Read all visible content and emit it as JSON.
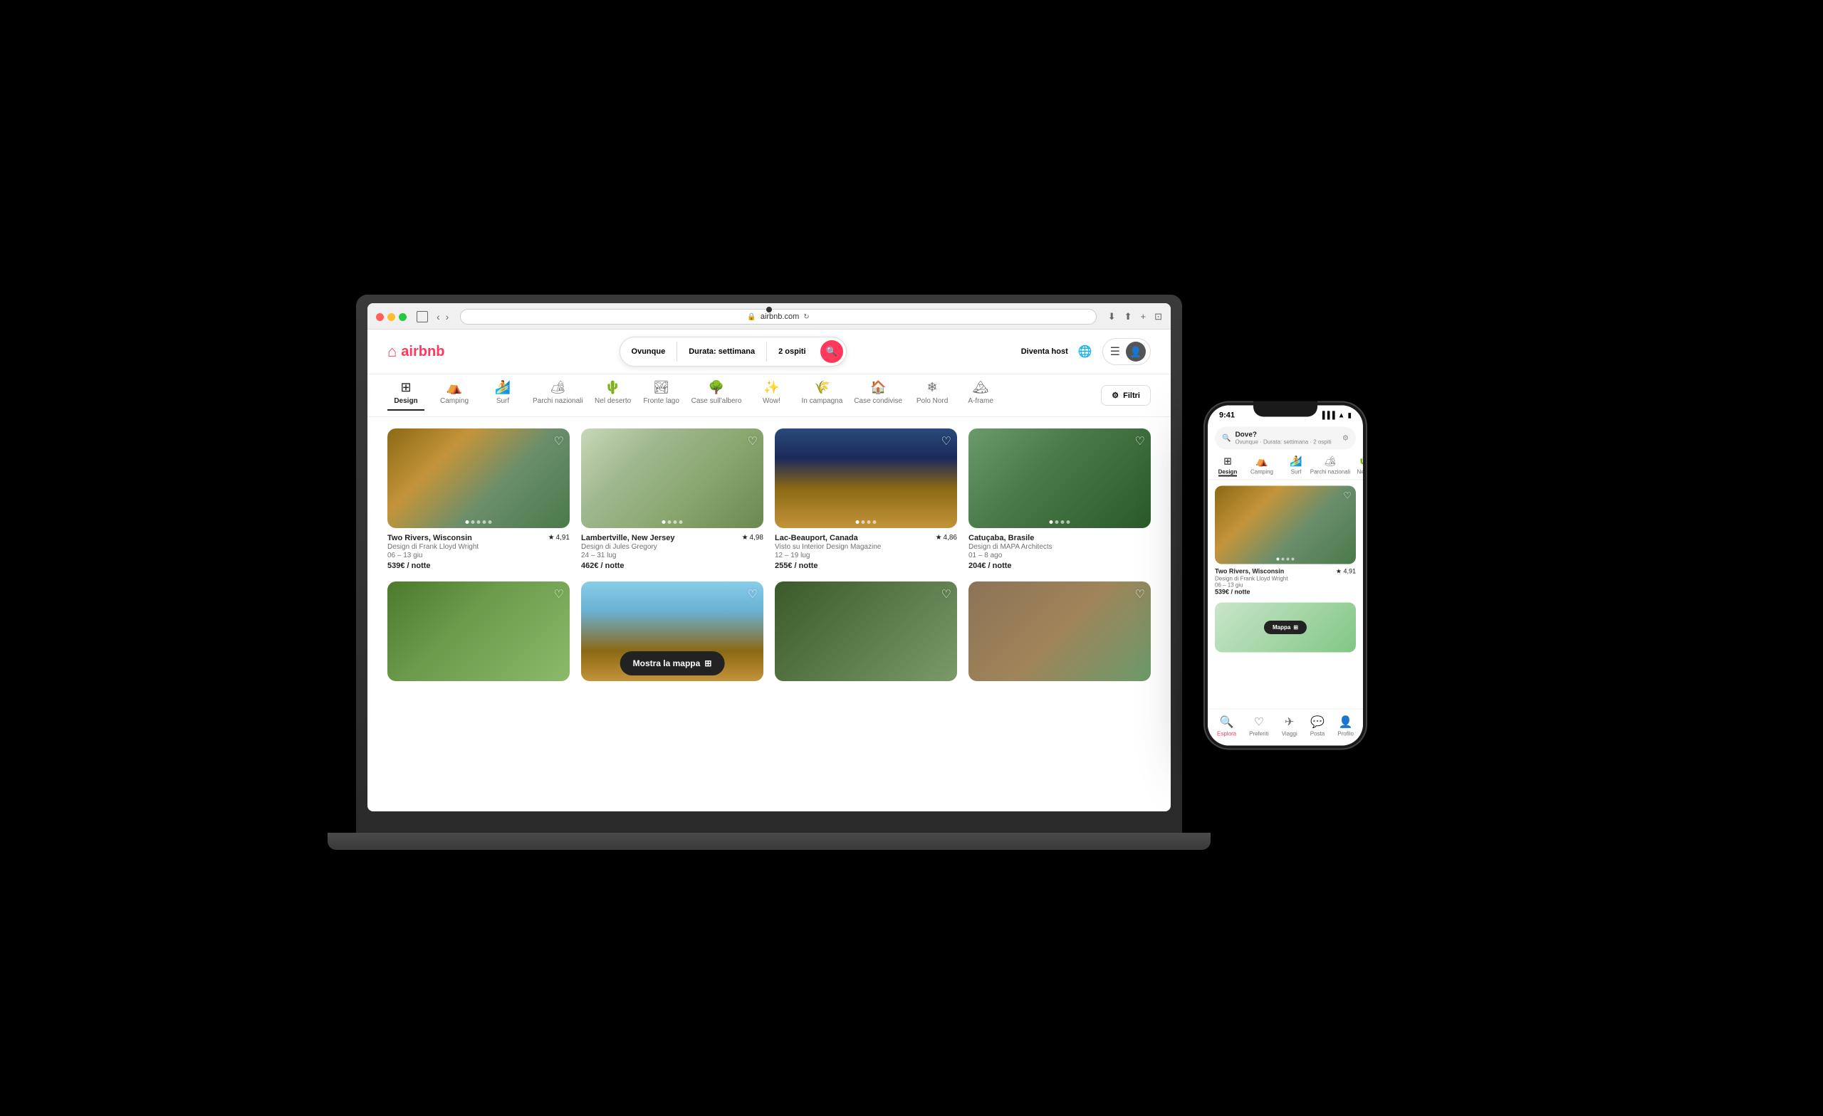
{
  "browser": {
    "url": "airbnb.com",
    "traffic_lights": [
      "red",
      "yellow",
      "green"
    ]
  },
  "airbnb": {
    "logo_text": "airbnb",
    "search": {
      "location": "Ovunque",
      "duration": "Durata: settimana",
      "guests": "2 ospiti"
    },
    "nav_right": {
      "host": "Diventa host",
      "menu_icon": "☰",
      "globe": "🌐"
    },
    "categories": [
      {
        "id": "design",
        "label": "Design",
        "icon": "⊞",
        "active": true
      },
      {
        "id": "camping",
        "label": "Camping",
        "icon": "⛺"
      },
      {
        "id": "surf",
        "label": "Surf",
        "icon": "🏄"
      },
      {
        "id": "parchi",
        "label": "Parchi nazionali",
        "icon": "🏕"
      },
      {
        "id": "deserto",
        "label": "Nel deserto",
        "icon": "🌵"
      },
      {
        "id": "lago",
        "label": "Fronte lago",
        "icon": "🏞"
      },
      {
        "id": "albero",
        "label": "Case sull'albero",
        "icon": "🌳"
      },
      {
        "id": "wow",
        "label": "Wow!",
        "icon": "✨"
      },
      {
        "id": "campagna",
        "label": "In campagna",
        "icon": "🌾"
      },
      {
        "id": "condivise",
        "label": "Case condivise",
        "icon": "🏠"
      },
      {
        "id": "polo",
        "label": "Polo Nord",
        "icon": "❄"
      },
      {
        "id": "aframe",
        "label": "A-frame",
        "icon": "🏔"
      }
    ],
    "filter_btn": "Filtri",
    "listings_row1": [
      {
        "location": "Two Rivers, Wisconsin",
        "rating": "4,91",
        "desc": "Design di Frank Lloyd Wright",
        "dates": "06 – 13 giu",
        "price": "539€ / notte",
        "img_class": "img-two-rivers"
      },
      {
        "location": "Lambertville, New Jersey",
        "rating": "4,98",
        "desc": "Design di Jules Gregory",
        "dates": "24 – 31 lug",
        "price": "462€ / notte",
        "img_class": "img-lambertville"
      },
      {
        "location": "Lac-Beauport, Canada",
        "rating": "4,86",
        "desc": "Visto su Interior Design Magazine",
        "dates": "12 – 19 lug",
        "price": "255€ / notte",
        "img_class": "img-lac-beauport"
      },
      {
        "location": "Catuçaba, Brasile",
        "rating": "",
        "desc": "Design di MAPA Architects",
        "dates": "01 – 8 ago",
        "price": "204€ / notte",
        "img_class": "img-catucaba"
      }
    ],
    "listings_row2": [
      {
        "img_class": "img-treehouse"
      },
      {
        "img_class": "img-modern"
      },
      {
        "img_class": "img-interior"
      },
      {
        "img_class": "img-brick"
      }
    ],
    "show_map": "Mostra la mappa"
  },
  "phone": {
    "time": "9:41",
    "search_placeholder": "Dove?",
    "search_subtitle": "Ovunque · Durata: settimana · 2 ospiti",
    "categories": [
      {
        "label": "Design",
        "icon": "⊞",
        "active": true
      },
      {
        "label": "Camping",
        "icon": "⛺"
      },
      {
        "label": "Surf",
        "icon": "🏄"
      },
      {
        "label": "Parchi nazionali",
        "icon": "🏕"
      },
      {
        "label": "Nel d.",
        "icon": "🌵"
      }
    ],
    "listing1": {
      "location": "Two Rivers, Wisconsin",
      "rating": "4,91",
      "desc": "Design di Frank Lloyd Wright",
      "dates": "06 – 13 giu",
      "price": "539€ / notte",
      "img_class": "img-two-rivers"
    },
    "map_btn": "Mappa",
    "bottom_nav": [
      {
        "label": "Esplora",
        "icon": "🔍",
        "active": true
      },
      {
        "label": "Preferiti",
        "icon": "♡"
      },
      {
        "label": "Viaggi",
        "icon": "✈"
      },
      {
        "label": "Posta",
        "icon": "💬"
      },
      {
        "label": "Profilo",
        "icon": "👤"
      }
    ]
  }
}
